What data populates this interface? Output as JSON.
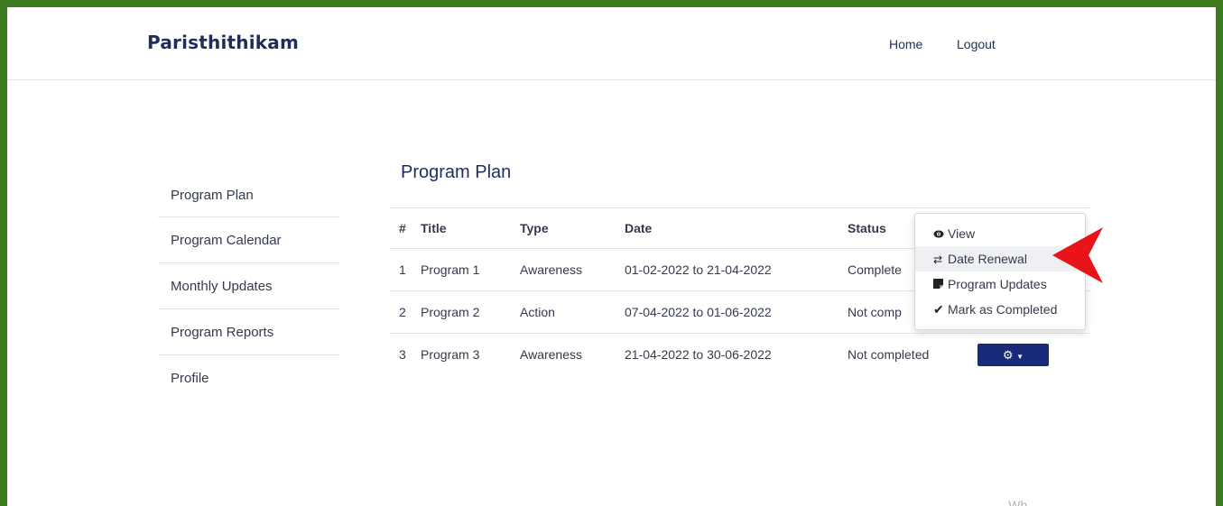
{
  "navbar": {
    "brand": "Paristhithikam",
    "links": [
      "Home",
      "Logout"
    ]
  },
  "sidebar": {
    "items": [
      "Program Plan",
      "Program Calendar",
      "Monthly Updates",
      "Program Reports",
      "Profile"
    ]
  },
  "main": {
    "title": "Program Plan",
    "table": {
      "headers": [
        "#",
        "Title",
        "Type",
        "Date",
        "Status"
      ],
      "rows": [
        [
          "1",
          "Program 1",
          "Awareness",
          "01-02-2022 to 21-04-2022",
          "Complete"
        ],
        [
          "2",
          "Program 2",
          "Action",
          "07-04-2022 to 01-06-2022",
          "Not comp"
        ],
        [
          "3",
          "Program 3",
          "Awareness",
          "21-04-2022 to 30-06-2022",
          "Not completed"
        ]
      ]
    },
    "action_button": {
      "icon": "gear-icon",
      "caret": "caret-down-icon"
    }
  },
  "dropdown": {
    "items": [
      {
        "label": "View",
        "icon": "eye-icon"
      },
      {
        "label": "Date Renewal",
        "icon": "arrows-exchange-icon"
      },
      {
        "label": "Program Updates",
        "icon": "note-icon"
      },
      {
        "label": "Mark as Completed",
        "icon": "check-icon"
      }
    ],
    "active_index": 1
  },
  "footer": {
    "partial_text": "... ...Wh..."
  },
  "colors": {
    "brand": "#1f2d5a",
    "border": "#3b7a1e",
    "button": "#1a2a7a",
    "arrow": "#e8141a"
  }
}
